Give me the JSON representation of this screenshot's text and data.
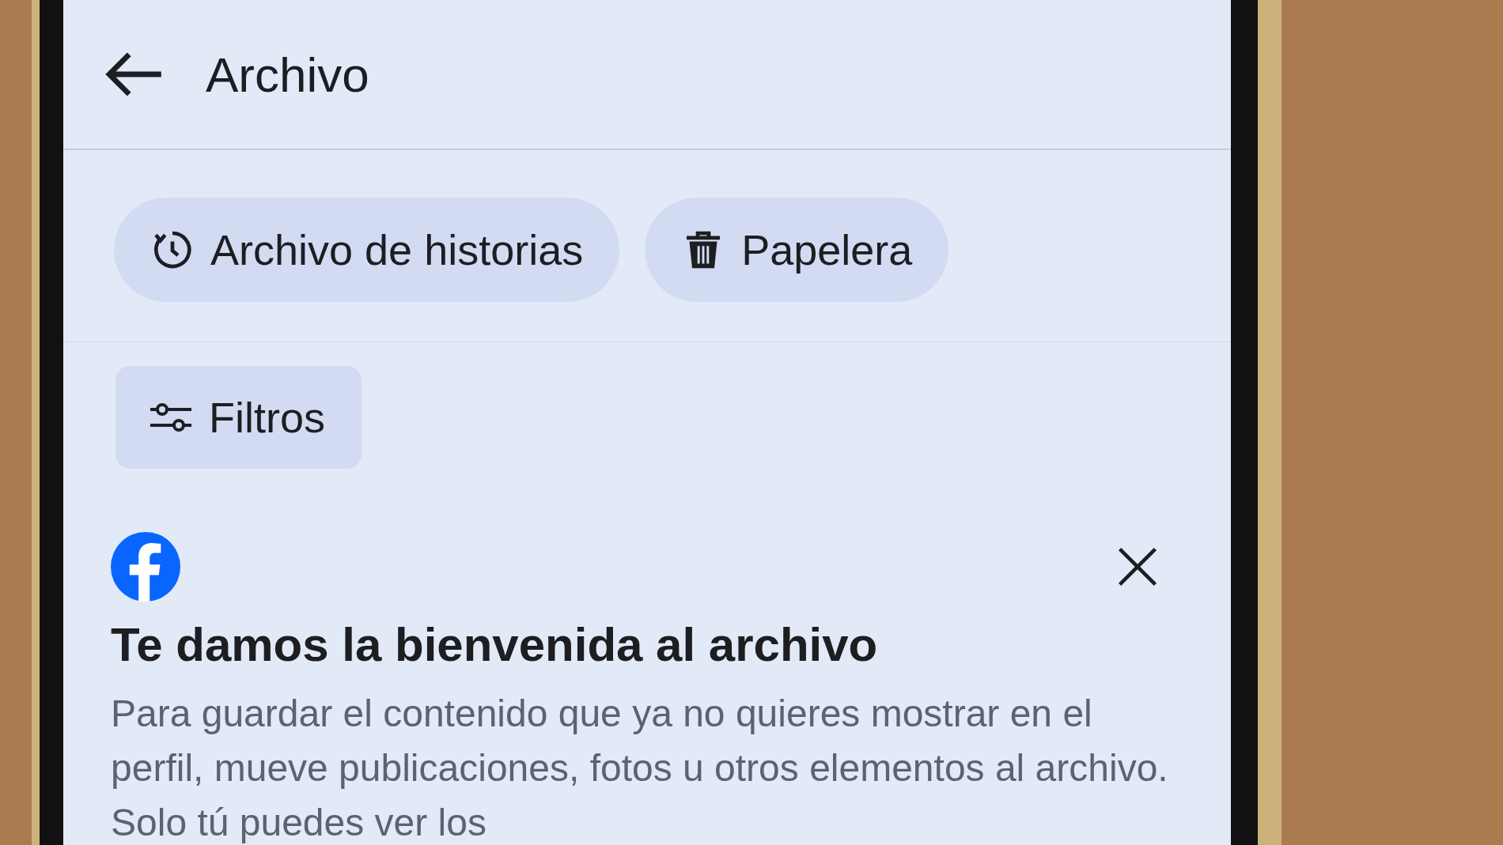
{
  "header": {
    "title": "Archivo"
  },
  "chips": [
    {
      "label": "Archivo de historias",
      "kind": "history"
    },
    {
      "label": "Papelera",
      "kind": "trash"
    }
  ],
  "filter": {
    "label": "Filtros"
  },
  "welcome": {
    "title": "Te damos la bienvenida al archivo",
    "body": "Para guardar el contenido que ya no quieres mostrar en el perfil, mueve publicaciones, fotos u otros elementos al archivo. Solo tú puedes ver los"
  }
}
